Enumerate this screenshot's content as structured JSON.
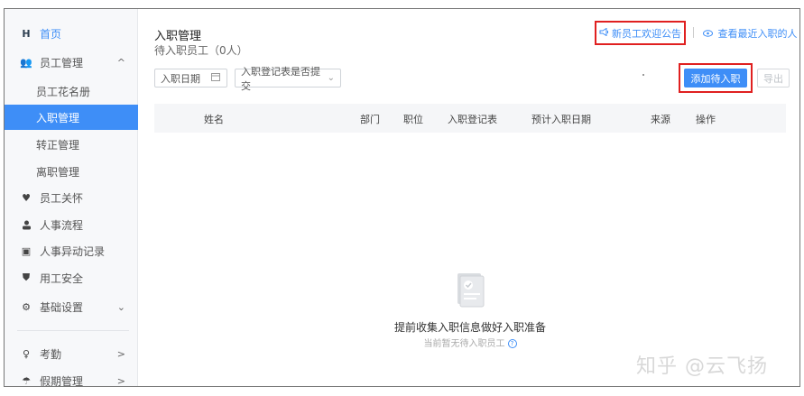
{
  "sidebar": {
    "home": {
      "label": "首页",
      "icon": "home-icon"
    },
    "employee_mgmt": {
      "label": "员工管理",
      "arrow": "^",
      "icon": "people-icon"
    },
    "sub_items": [
      {
        "label": "员工花名册"
      },
      {
        "label": "入职管理",
        "active": true
      },
      {
        "label": "转正管理"
      },
      {
        "label": "离职管理"
      }
    ],
    "items": [
      {
        "label": "员工关怀",
        "icon": "heart-icon",
        "glyph": "♥"
      },
      {
        "label": "人事流程",
        "icon": "person-icon",
        "glyph": "👤"
      },
      {
        "label": "人事异动记录",
        "icon": "record-icon",
        "glyph": "▣"
      },
      {
        "label": "用工安全",
        "icon": "shield-icon",
        "glyph": "⛊"
      },
      {
        "label": "基础设置",
        "icon": "gear-icon",
        "glyph": "⚙",
        "arrow": "⌄"
      }
    ],
    "bottom": [
      {
        "label": "考勤",
        "icon": "attendance-icon",
        "glyph": "♀",
        "arrow": ">"
      },
      {
        "label": "假期管理",
        "icon": "vacation-icon",
        "glyph": "☂",
        "arrow": ">"
      }
    ]
  },
  "header": {
    "title": "入职管理",
    "subtitle": "待入职员工（0人）",
    "announce_label": "新员工欢迎公告",
    "recent_label": "查看最近入职的人"
  },
  "filters": {
    "date_label": "入职日期",
    "form_label": "入职登记表是否提交"
  },
  "actions": {
    "add_label": "添加待入职",
    "export_label": "导出"
  },
  "table": {
    "columns": [
      "姓名",
      "部门",
      "职位",
      "入职登记表",
      "预计入职日期",
      "来源",
      "操作"
    ]
  },
  "empty": {
    "title": "提前收集入职信息做好入职准备",
    "subtitle": "当前暂无待入职员工"
  },
  "watermark": "知乎 @云飞扬",
  "colors": {
    "accent": "#3e8ef7",
    "highlight": "#e02020"
  }
}
